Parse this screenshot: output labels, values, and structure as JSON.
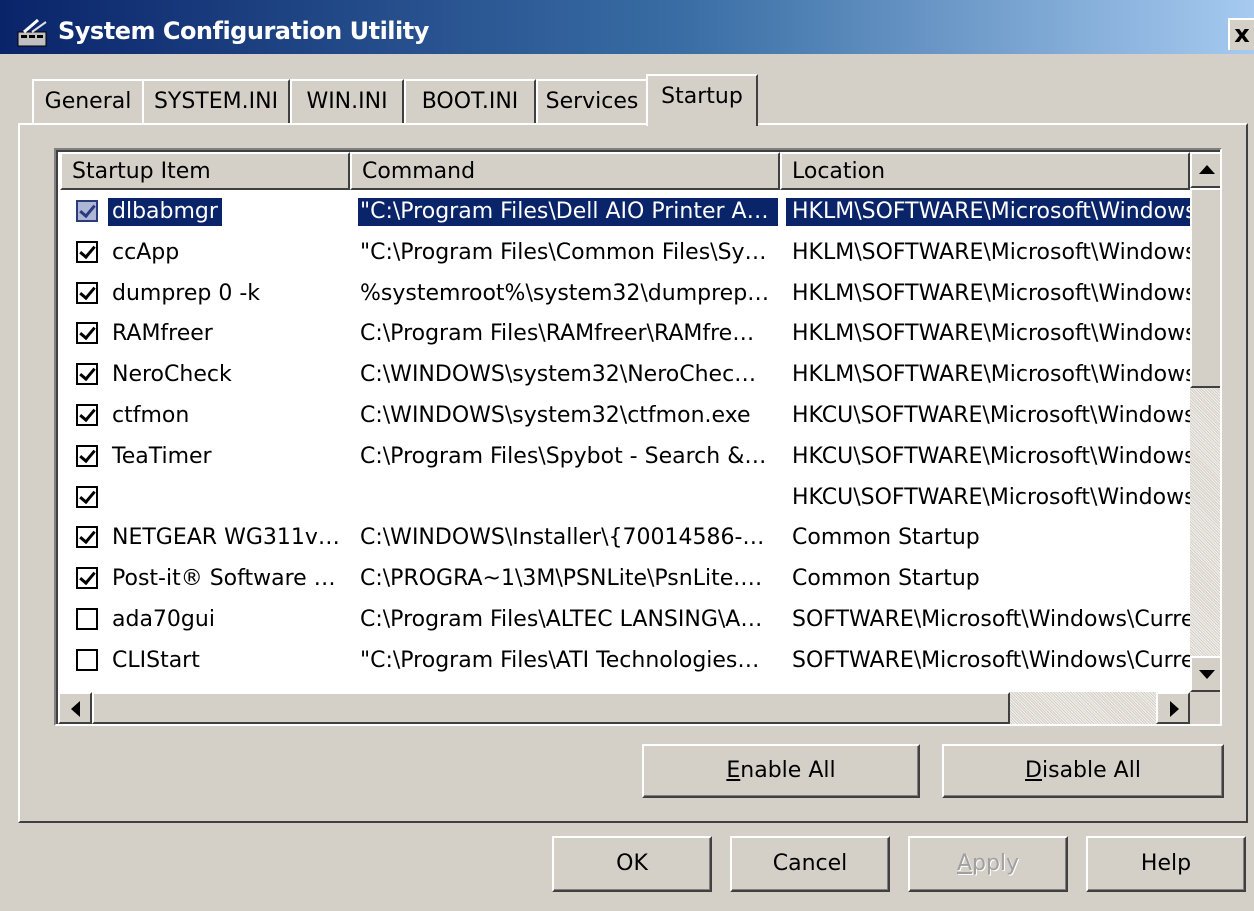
{
  "window": {
    "title": "System Configuration Utility",
    "close_label": "x"
  },
  "tabs": [
    {
      "label": "General"
    },
    {
      "label": "SYSTEM.INI"
    },
    {
      "label": "WIN.INI"
    },
    {
      "label": "BOOT.INI"
    },
    {
      "label": "Services"
    },
    {
      "label": "Startup",
      "active": true
    }
  ],
  "list": {
    "columns": [
      "Startup Item",
      "Command",
      "Location"
    ],
    "rows": [
      {
        "checked": true,
        "item": "dlbabmgr",
        "command": "\"C:\\Program Files\\Dell AIO Printer A…",
        "location": "HKLM\\SOFTWARE\\Microsoft\\Windows",
        "selected": true
      },
      {
        "checked": true,
        "item": "ccApp",
        "command": "\"C:\\Program Files\\Common Files\\Sy…",
        "location": "HKLM\\SOFTWARE\\Microsoft\\Windows"
      },
      {
        "checked": true,
        "item": "dumprep 0 -k",
        "command": "%systemroot%\\system32\\dumprep…",
        "location": "HKLM\\SOFTWARE\\Microsoft\\Windows"
      },
      {
        "checked": true,
        "item": "RAMfreer",
        "command": "C:\\Program Files\\RAMfreer\\RAMfre…",
        "location": "HKLM\\SOFTWARE\\Microsoft\\Windows"
      },
      {
        "checked": true,
        "item": "NeroCheck",
        "command": "C:\\WINDOWS\\system32\\NeroChec…",
        "location": "HKLM\\SOFTWARE\\Microsoft\\Windows"
      },
      {
        "checked": true,
        "item": "ctfmon",
        "command": "C:\\WINDOWS\\system32\\ctfmon.exe",
        "location": "HKCU\\SOFTWARE\\Microsoft\\Windows"
      },
      {
        "checked": true,
        "item": "TeaTimer",
        "command": "C:\\Program Files\\Spybot - Search &…",
        "location": "HKCU\\SOFTWARE\\Microsoft\\Windows"
      },
      {
        "checked": true,
        "item": "",
        "command": "",
        "location": "HKCU\\SOFTWARE\\Microsoft\\Windows"
      },
      {
        "checked": true,
        "item": "NETGEAR WG311v…",
        "command": "C:\\WINDOWS\\Installer\\{70014586-…",
        "location": "Common Startup"
      },
      {
        "checked": true,
        "item": "Post-it® Software …",
        "command": "C:\\PROGRA~1\\3M\\PSNLite\\PsnLite.…",
        "location": "Common Startup"
      },
      {
        "checked": false,
        "item": "ada70gui",
        "command": "C:\\Program Files\\ALTEC LANSING\\A…",
        "location": "SOFTWARE\\Microsoft\\Windows\\Curre"
      },
      {
        "checked": false,
        "item": "CLIStart",
        "command": "\"C:\\Program Files\\ATI Technologies…",
        "location": "SOFTWARE\\Microsoft\\Windows\\Curre"
      }
    ]
  },
  "buttons": {
    "enable_all": {
      "pre": "",
      "mnemonic": "E",
      "post": "nable All"
    },
    "disable_all": {
      "pre": "",
      "mnemonic": "D",
      "post": "isable All"
    },
    "ok": "OK",
    "cancel": "Cancel",
    "apply": {
      "pre": "",
      "mnemonic": "A",
      "post": "pply",
      "disabled": true
    },
    "help": "Help"
  },
  "colors": {
    "face": "#d4d0c8",
    "titlebar_start": "#0a246a",
    "titlebar_end": "#a6caf0",
    "selection": "#0a246a"
  }
}
